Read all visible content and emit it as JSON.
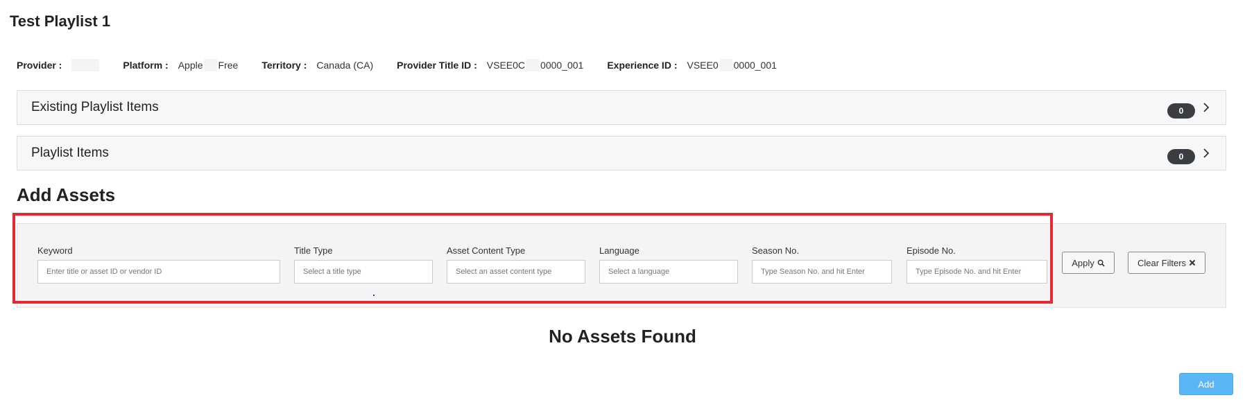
{
  "page": {
    "title": "Test Playlist 1"
  },
  "meta": {
    "provider_label": "Provider :",
    "platform_label": "Platform :",
    "platform_value_a": "Apple",
    "platform_value_b": "Free",
    "territory_label": "Territory :",
    "territory_value": "Canada (CA)",
    "provider_title_id_label": "Provider Title ID :",
    "provider_title_id_prefix": "VSEE0C",
    "provider_title_id_suffix": "0000_001",
    "experience_id_label": "Experience ID :",
    "experience_id_prefix": "VSEE0",
    "experience_id_suffix": "0000_001"
  },
  "accordions": [
    {
      "title": "Existing Playlist Items",
      "count": "0"
    },
    {
      "title": "Playlist Items",
      "count": "0"
    }
  ],
  "add_assets": {
    "title": "Add Assets",
    "filters": {
      "keyword": {
        "label": "Keyword",
        "placeholder": "Enter title or asset ID or vendor ID"
      },
      "title_type": {
        "label": "Title Type",
        "placeholder": "Select a title type"
      },
      "asset_content_type": {
        "label": "Asset Content Type",
        "placeholder": "Select an asset content type"
      },
      "language": {
        "label": "Language",
        "placeholder": "Select a language"
      },
      "season": {
        "label": "Season No.",
        "placeholder": "Type Season No. and hit Enter"
      },
      "episode": {
        "label": "Episode No.",
        "placeholder": "Type Episode No. and hit Enter"
      }
    },
    "apply_label": "Apply",
    "clear_label": "Clear Filters",
    "empty_message": "No Assets Found",
    "add_label": "Add"
  },
  "colors": {
    "highlight": "#e32a33",
    "primary": "#5bb6f5",
    "badge": "#3a3e43"
  },
  "icons": {
    "apply": "search-icon",
    "clear": "times-icon",
    "expand": "chevron-right-icon"
  }
}
